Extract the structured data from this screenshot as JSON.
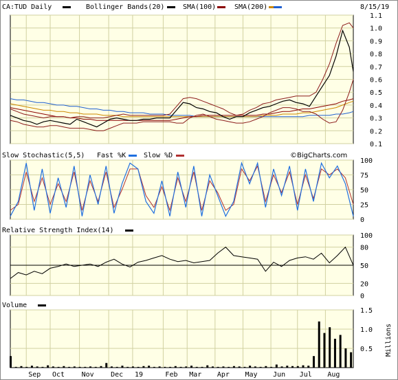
{
  "chart_data": [
    {
      "type": "line",
      "title": "CA:TUD Daily",
      "date": "8/15/19",
      "legend": [
        {
          "name": "CA:TUD Daily",
          "color": "#000000"
        },
        {
          "name": "Bollinger Bands(20)",
          "color": "#000000"
        },
        {
          "name": "SMA(100)",
          "color": "#8b0000"
        },
        {
          "name": "SMA(200)",
          "color": "#cc8800"
        },
        {
          "name": "",
          "color": "#1f5fd0"
        }
      ],
      "ylim": [
        0.1,
        1.1
      ],
      "yticks": [
        "1.1",
        "1.0",
        "0.9",
        "0.8",
        "0.7",
        "0.6",
        "0.5",
        "0.4",
        "0.3",
        "0.2",
        "0.1"
      ],
      "grid": true,
      "x": [
        0,
        5,
        10,
        15,
        20,
        25,
        30,
        35,
        40,
        45,
        50,
        55,
        60,
        65,
        70,
        75,
        80,
        85,
        90,
        95,
        100,
        105,
        110,
        115,
        120,
        125,
        130,
        135,
        140,
        145,
        150,
        155,
        160,
        165,
        170,
        175,
        180,
        185,
        190,
        195,
        200,
        205,
        210,
        215,
        220,
        225,
        230,
        235,
        240,
        245,
        250,
        255,
        258
      ],
      "series": [
        {
          "name": "CA:TUD Daily",
          "values": [
            0.32,
            0.3,
            0.28,
            0.27,
            0.25,
            0.27,
            0.28,
            0.27,
            0.26,
            0.25,
            0.29,
            0.27,
            0.25,
            0.23,
            0.26,
            0.29,
            0.3,
            0.29,
            0.28,
            0.28,
            0.29,
            0.29,
            0.3,
            0.3,
            0.3,
            0.36,
            0.42,
            0.41,
            0.38,
            0.37,
            0.35,
            0.34,
            0.31,
            0.29,
            0.31,
            0.31,
            0.34,
            0.36,
            0.38,
            0.39,
            0.41,
            0.43,
            0.44,
            0.42,
            0.41,
            0.39,
            0.47,
            0.55,
            0.63,
            0.78,
            0.98,
            0.85,
            0.66
          ]
        },
        {
          "name": "Bollinger Bands(20) upper",
          "values": [
            0.37,
            0.35,
            0.33,
            0.32,
            0.31,
            0.3,
            0.31,
            0.31,
            0.31,
            0.3,
            0.31,
            0.31,
            0.3,
            0.3,
            0.3,
            0.31,
            0.32,
            0.33,
            0.32,
            0.32,
            0.32,
            0.32,
            0.32,
            0.32,
            0.33,
            0.39,
            0.45,
            0.46,
            0.45,
            0.43,
            0.41,
            0.39,
            0.37,
            0.34,
            0.32,
            0.33,
            0.36,
            0.38,
            0.41,
            0.42,
            0.44,
            0.45,
            0.46,
            0.47,
            0.47,
            0.47,
            0.5,
            0.6,
            0.72,
            0.88,
            1.02,
            1.04,
            1.0
          ]
        },
        {
          "name": "Bollinger Bands(20) lower",
          "values": [
            0.28,
            0.27,
            0.25,
            0.24,
            0.23,
            0.23,
            0.24,
            0.24,
            0.23,
            0.22,
            0.22,
            0.22,
            0.21,
            0.2,
            0.2,
            0.22,
            0.24,
            0.26,
            0.26,
            0.26,
            0.27,
            0.27,
            0.27,
            0.27,
            0.27,
            0.26,
            0.26,
            0.3,
            0.32,
            0.33,
            0.31,
            0.29,
            0.28,
            0.27,
            0.26,
            0.26,
            0.27,
            0.29,
            0.31,
            0.34,
            0.36,
            0.38,
            0.38,
            0.37,
            0.35,
            0.35,
            0.33,
            0.29,
            0.26,
            0.27,
            0.36,
            0.5,
            0.6
          ]
        },
        {
          "name": "SMA(100)",
          "values": [
            0.38,
            0.37,
            0.36,
            0.35,
            0.34,
            0.33,
            0.32,
            0.31,
            0.31,
            0.3,
            0.3,
            0.29,
            0.29,
            0.28,
            0.28,
            0.28,
            0.28,
            0.28,
            0.28,
            0.28,
            0.28,
            0.28,
            0.28,
            0.28,
            0.28,
            0.29,
            0.3,
            0.31,
            0.31,
            0.32,
            0.32,
            0.32,
            0.32,
            0.32,
            0.32,
            0.32,
            0.32,
            0.32,
            0.33,
            0.33,
            0.34,
            0.35,
            0.35,
            0.36,
            0.37,
            0.37,
            0.38,
            0.39,
            0.4,
            0.41,
            0.43,
            0.44,
            0.45
          ]
        },
        {
          "name": "SMA(200)",
          "values": [
            0.41,
            0.4,
            0.39,
            0.38,
            0.37,
            0.36,
            0.36,
            0.35,
            0.35,
            0.34,
            0.34,
            0.33,
            0.33,
            0.33,
            0.32,
            0.32,
            0.32,
            0.31,
            0.31,
            0.31,
            0.31,
            0.31,
            0.31,
            0.31,
            0.31,
            0.31,
            0.31,
            0.31,
            0.31,
            0.31,
            0.31,
            0.31,
            0.31,
            0.31,
            0.31,
            0.31,
            0.31,
            0.31,
            0.32,
            0.32,
            0.32,
            0.33,
            0.33,
            0.33,
            0.34,
            0.34,
            0.35,
            0.36,
            0.37,
            0.38,
            0.4,
            0.42,
            0.43
          ]
        },
        {
          "name": "",
          "values": [
            0.45,
            0.44,
            0.44,
            0.43,
            0.42,
            0.42,
            0.41,
            0.4,
            0.4,
            0.39,
            0.39,
            0.38,
            0.37,
            0.37,
            0.36,
            0.36,
            0.35,
            0.35,
            0.34,
            0.34,
            0.34,
            0.33,
            0.33,
            0.33,
            0.32,
            0.32,
            0.32,
            0.32,
            0.31,
            0.31,
            0.31,
            0.31,
            0.31,
            0.31,
            0.31,
            0.31,
            0.31,
            0.31,
            0.31,
            0.31,
            0.31,
            0.31,
            0.31,
            0.31,
            0.31,
            0.32,
            0.32,
            0.32,
            0.32,
            0.33,
            0.33,
            0.34,
            0.35
          ]
        }
      ]
    },
    {
      "type": "line",
      "title": "Slow Stochastic(5,5)",
      "brand": "©BigCharts.com",
      "legend": [
        {
          "name": "Fast %K",
          "color": "#1f6fe0"
        },
        {
          "name": "Slow %D",
          "color": "#b03030"
        }
      ],
      "ylim": [
        0,
        100
      ],
      "yticks": [
        "100",
        "75",
        "50",
        "25",
        "0"
      ],
      "grid": true,
      "x": [
        0,
        6,
        12,
        18,
        24,
        30,
        36,
        42,
        48,
        54,
        60,
        66,
        72,
        78,
        84,
        90,
        96,
        102,
        108,
        114,
        120,
        126,
        132,
        138,
        144,
        150,
        156,
        162,
        168,
        174,
        180,
        186,
        192,
        198,
        204,
        210,
        216,
        222,
        228,
        234,
        240,
        246,
        252,
        258
      ],
      "series": [
        {
          "name": "Fast %K",
          "values": [
            5,
            30,
            95,
            15,
            85,
            10,
            70,
            20,
            90,
            5,
            75,
            25,
            90,
            10,
            60,
            95,
            85,
            30,
            10,
            65,
            5,
            80,
            20,
            90,
            5,
            75,
            40,
            5,
            30,
            95,
            60,
            95,
            20,
            85,
            40,
            90,
            15,
            85,
            30,
            95,
            70,
            90,
            60,
            5
          ]
        },
        {
          "name": "Slow %D",
          "values": [
            15,
            25,
            80,
            30,
            70,
            25,
            60,
            30,
            80,
            15,
            65,
            30,
            80,
            20,
            50,
            85,
            85,
            40,
            20,
            55,
            15,
            70,
            30,
            80,
            15,
            65,
            45,
            15,
            25,
            85,
            65,
            90,
            30,
            75,
            45,
            80,
            25,
            75,
            35,
            85,
            75,
            85,
            70,
            25
          ]
        }
      ]
    },
    {
      "type": "line",
      "title": "Relative Strength Index(14)",
      "legend": [
        {
          "name": "Relative Strength Index(14)",
          "color": "#000000"
        }
      ],
      "ylim": [
        0,
        100
      ],
      "yticks": [
        "100",
        "80",
        "50",
        "20",
        "0"
      ],
      "reference_line": 50,
      "grid": true,
      "x": [
        0,
        6,
        12,
        18,
        24,
        30,
        36,
        42,
        48,
        54,
        60,
        66,
        72,
        78,
        84,
        90,
        96,
        102,
        108,
        114,
        120,
        126,
        132,
        138,
        144,
        150,
        156,
        162,
        168,
        174,
        180,
        186,
        192,
        198,
        204,
        210,
        216,
        222,
        228,
        234,
        240,
        246,
        252,
        258
      ],
      "series": [
        {
          "name": "Relative Strength Index(14)",
          "values": [
            28,
            38,
            34,
            40,
            36,
            45,
            48,
            52,
            48,
            50,
            52,
            48,
            55,
            60,
            52,
            47,
            55,
            58,
            62,
            66,
            60,
            56,
            58,
            54,
            56,
            58,
            70,
            80,
            66,
            64,
            62,
            60,
            40,
            55,
            48,
            58,
            62,
            64,
            60,
            70,
            54,
            66,
            80,
            50
          ]
        }
      ]
    },
    {
      "type": "bar",
      "title": "Volume",
      "ylabel": "Millions",
      "ylim": [
        0,
        1.5
      ],
      "yticks": [
        "1.5",
        "1.0",
        "0.5"
      ],
      "grid": true,
      "x": [
        0,
        4,
        8,
        12,
        16,
        20,
        24,
        28,
        32,
        36,
        40,
        44,
        48,
        52,
        56,
        60,
        64,
        68,
        72,
        76,
        80,
        84,
        88,
        92,
        96,
        100,
        104,
        108,
        112,
        116,
        120,
        124,
        128,
        132,
        136,
        140,
        144,
        148,
        152,
        156,
        160,
        164,
        168,
        172,
        176,
        180,
        184,
        188,
        192,
        196,
        200,
        204,
        208,
        212,
        216,
        220,
        224,
        228,
        232,
        236,
        240,
        244,
        248,
        252,
        256
      ],
      "values": [
        0.3,
        0.02,
        0.04,
        0.02,
        0.05,
        0.03,
        0.02,
        0.06,
        0.03,
        0.02,
        0.04,
        0.02,
        0.03,
        0.02,
        0.02,
        0.03,
        0.02,
        0.04,
        0.12,
        0.03,
        0.02,
        0.05,
        0.02,
        0.03,
        0.02,
        0.04,
        0.05,
        0.02,
        0.03,
        0.02,
        0.02,
        0.04,
        0.02,
        0.03,
        0.05,
        0.02,
        0.02,
        0.06,
        0.03,
        0.02,
        0.03,
        0.02,
        0.04,
        0.03,
        0.02,
        0.05,
        0.03,
        0.02,
        0.04,
        0.02,
        0.08,
        0.03,
        0.05,
        0.04,
        0.04,
        0.06,
        0.05,
        0.3,
        1.2,
        0.9,
        1.05,
        0.75,
        0.85,
        0.5,
        0.4
      ]
    }
  ],
  "x_axis": {
    "tick_labels": [
      "Sep",
      "Oct",
      "Nov",
      "Dec",
      "19",
      "Feb",
      "Mar",
      "Apr",
      "May",
      "Jun",
      "Jul",
      "Aug"
    ],
    "tick_x": [
      12,
      30,
      52,
      74,
      92,
      115,
      133,
      154,
      175,
      196,
      216,
      237
    ]
  }
}
